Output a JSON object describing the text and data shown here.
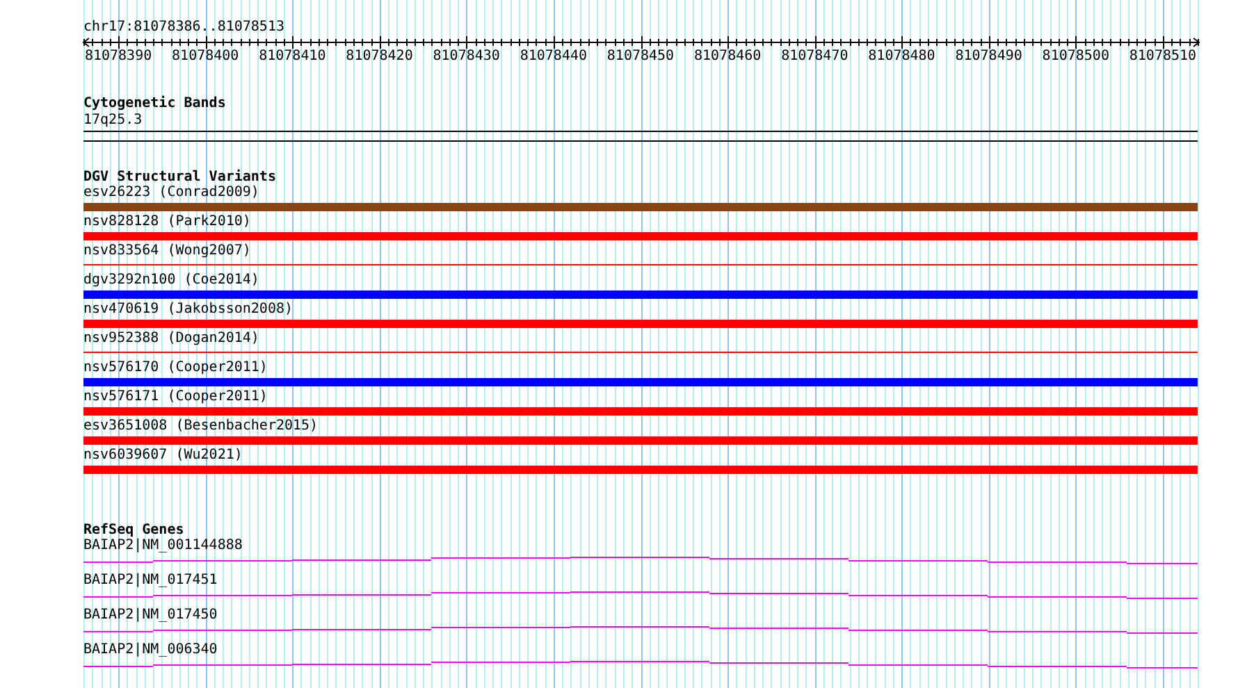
{
  "ruler": {
    "title": "chr17:81078386..81078513",
    "labels": [
      "81078390",
      "81078400",
      "81078410",
      "81078420",
      "81078430",
      "81078440",
      "81078450",
      "81078460",
      "81078470",
      "81078480",
      "81078490",
      "81078500",
      "81078510"
    ]
  },
  "cytogenetic_bands": {
    "title": "Cytogenetic Bands",
    "band": "17q25.3"
  },
  "dgv": {
    "title": "DGV Structural Variants",
    "variants": [
      {
        "label": "esv26223 (Conrad2009)",
        "color": "#8b4513",
        "kind": "thick"
      },
      {
        "label": "nsv828128 (Park2010)",
        "color": "#ff0000",
        "kind": "thick"
      },
      {
        "label": "nsv833564 (Wong2007)",
        "color": "#ff0000",
        "kind": "thin"
      },
      {
        "label": "dgv3292n100 (Coe2014)",
        "color": "#0000ff",
        "kind": "thick"
      },
      {
        "label": "nsv470619 (Jakobsson2008)",
        "color": "#ff0000",
        "kind": "thick"
      },
      {
        "label": "nsv952388 (Dogan2014)",
        "color": "#ff0000",
        "kind": "thin"
      },
      {
        "label": "nsv576170 (Cooper2011)",
        "color": "#0000ff",
        "kind": "thick"
      },
      {
        "label": "nsv576171 (Cooper2011)",
        "color": "#ff0000",
        "kind": "thick"
      },
      {
        "label": "esv3651008 (Besenbacher2015)",
        "color": "#ff0000",
        "kind": "thick"
      },
      {
        "label": "nsv6039607 (Wu2021)",
        "color": "#ff0000",
        "kind": "thick"
      }
    ]
  },
  "refseq": {
    "title": "RefSeq Genes",
    "genes": [
      {
        "label": "BAIAP2|NM_001144888"
      },
      {
        "label": "BAIAP2|NM_017451"
      },
      {
        "label": "BAIAP2|NM_017450"
      },
      {
        "label": "BAIAP2|NM_006340"
      }
    ]
  }
}
